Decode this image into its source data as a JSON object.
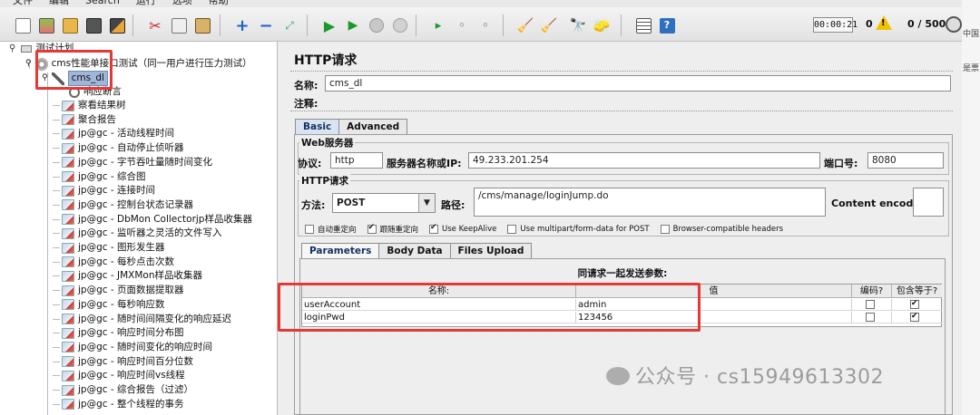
{
  "menu": [
    "文件",
    "编辑",
    "Search",
    "运行",
    "选项",
    "帮助"
  ],
  "toolbar": {
    "timer": "00:00:21",
    "error_count": "0",
    "warning_symbol": "!",
    "threads": "0 / 500"
  },
  "tree": {
    "root": "测试计划",
    "thread_group": "cms性能单接口测试（同一用户进行压力测试）",
    "sampler": "cms_dl",
    "assertion": "响应断言",
    "listeners": [
      "察看结果树",
      "聚合报告",
      "jp@gc - 活动线程时间",
      "jp@gc - 自动停止侦听器",
      "jp@gc - 字节吞吐量随时间变化",
      "jp@gc - 综合图",
      "jp@gc - 连接时间",
      "jp@gc - 控制台状态记录器",
      "jp@gc - DbMon Collectorjp样品收集器",
      "jp@gc - 监听器之灵活的文件写入",
      "jp@gc - 图形发生器",
      "jp@gc - 每秒点击次数",
      "jp@gc - JMXMon样品收集器",
      "jp@gc - 页面数据提取器",
      "jp@gc - 每秒响应数",
      "jp@gc - 随时间间隔变化的响应延迟",
      "jp@gc - 响应时间分布图",
      "jp@gc - 随时间变化的响应时间",
      "jp@gc - 响应时间百分位数",
      "jp@gc - 响应时间vs线程",
      "jp@gc - 综合报告（过滤）",
      "jp@gc - 整个线程的事务"
    ]
  },
  "panel": {
    "title": "HTTP请求",
    "name_label": "名称:",
    "name_value": "cms_dl",
    "comment_label": "注释:",
    "tabs": [
      "Basic",
      "Advanced"
    ],
    "web_server": {
      "title": "Web服务器",
      "protocol_label": "协议:",
      "protocol_value": "http",
      "host_label": "服务器名称或IP:",
      "host_value": "49.233.201.254",
      "port_label": "端口号:",
      "port_value": "8080"
    },
    "http_request": {
      "title": "HTTP请求",
      "method_label": "方法:",
      "method_value": "POST",
      "path_label": "路径:",
      "path_value": "/cms/manage/loginJump.do",
      "encoding_label": "Content encoding:"
    },
    "options": [
      {
        "label": "自动重定向",
        "checked": false
      },
      {
        "label": "跟随重定向",
        "checked": true
      },
      {
        "label": "Use KeepAlive",
        "checked": true
      },
      {
        "label": "Use multipart/form-data for POST",
        "checked": false
      },
      {
        "label": "Browser-compatible headers",
        "checked": false
      }
    ],
    "param_tabs": [
      "Parameters",
      "Body Data",
      "Files Upload"
    ],
    "params": {
      "caption": "同请求一起发送参数:",
      "headers": [
        "名称:",
        "值",
        "编码?",
        "包含等于?"
      ],
      "rows": [
        {
          "name": "userAccount",
          "value": "admin",
          "encode": false,
          "include_equals": true
        },
        {
          "name": "loginPwd",
          "value": "123456",
          "encode": false,
          "include_equals": true
        }
      ]
    }
  },
  "watermark": "公众号 · cs15949613302",
  "edge_text": [
    "中国",
    "是票"
  ]
}
